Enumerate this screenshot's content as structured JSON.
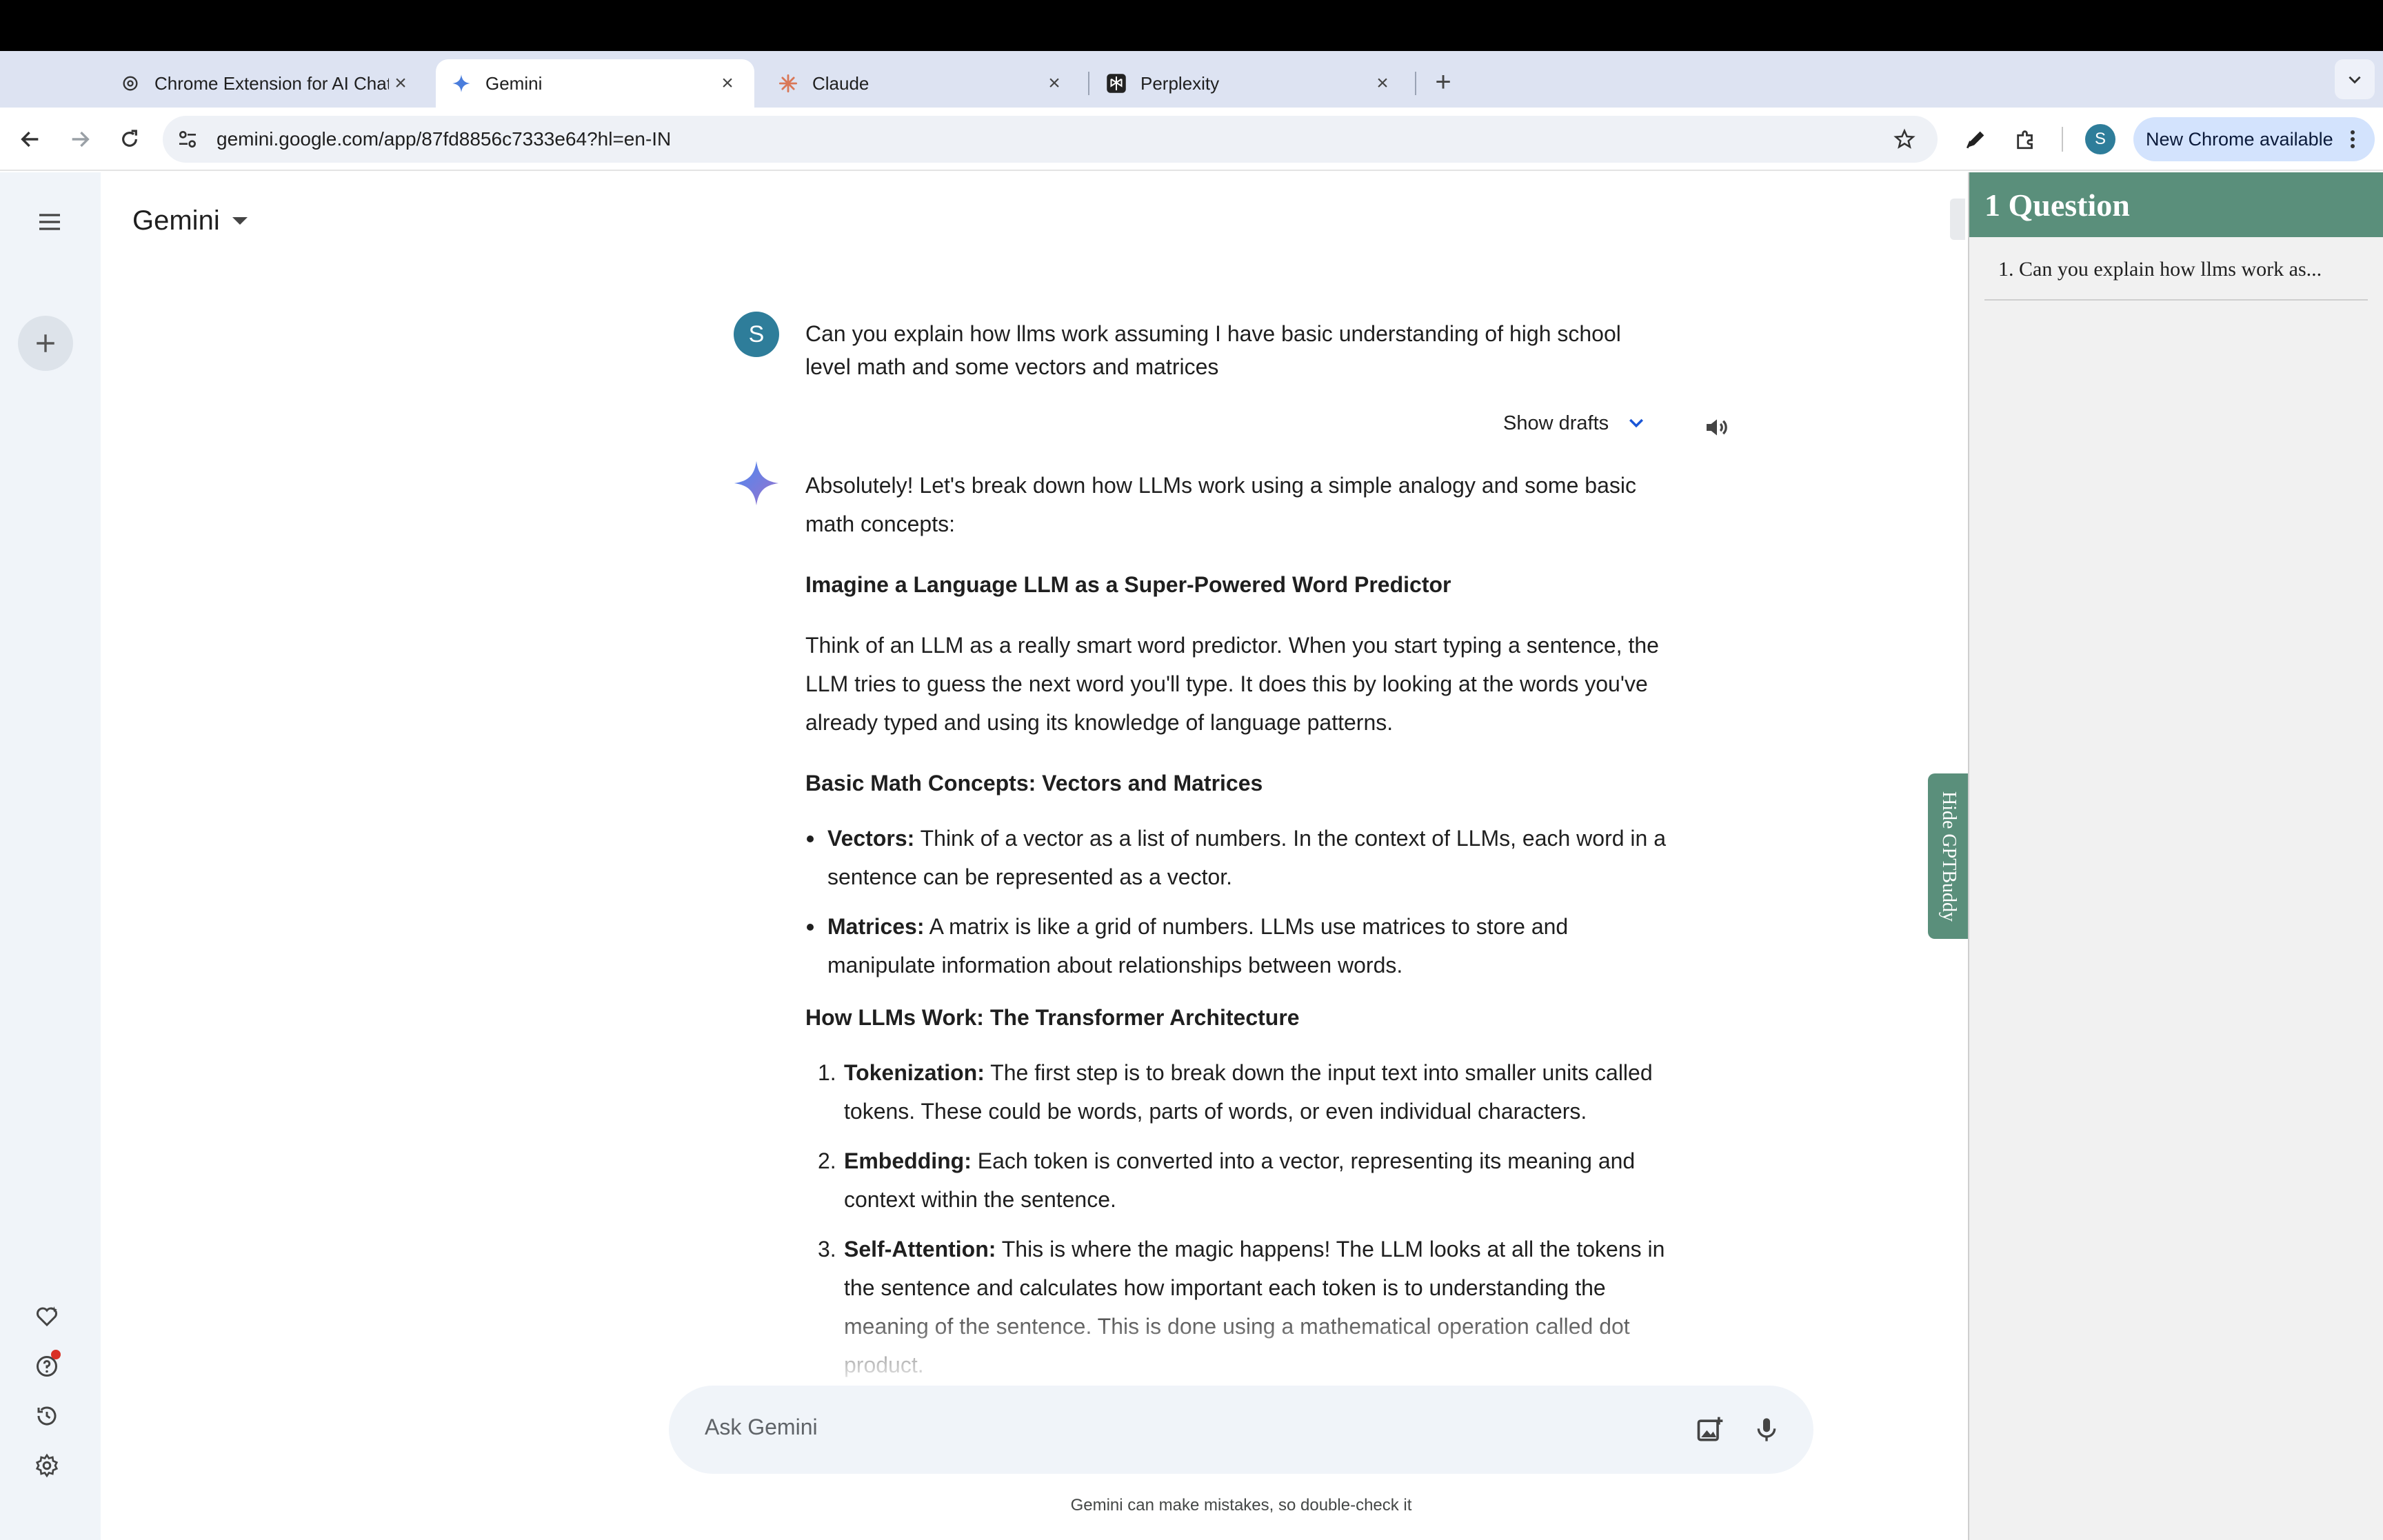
{
  "browser": {
    "tabs": [
      {
        "title": "Chrome Extension for AI Chat",
        "active": false
      },
      {
        "title": "Gemini",
        "active": true
      },
      {
        "title": "Claude",
        "active": false
      },
      {
        "title": "Perplexity",
        "active": false
      }
    ],
    "url": "gemini.google.com/app/87fd8856c7333e64?hl=en-IN",
    "profile_initial": "S",
    "update_label": "New Chrome available"
  },
  "app": {
    "brand": "Gemini"
  },
  "conversation": {
    "user_initial": "S",
    "user_question": "Can you explain how llms work assuming I have basic understanding of high school level math and some vectors and matrices",
    "show_drafts_label": "Show drafts",
    "answer": {
      "intro": "Absolutely! Let's break down how LLMs work using a simple analogy and some basic math concepts:",
      "heading1": "Imagine a Language LLM as a Super-Powered Word Predictor",
      "para1": "Think of an LLM as a really smart word predictor. When you start typing a sentence, the LLM tries to guess the next word you'll type. It does this by looking at the words you've already typed and using its knowledge of language patterns.",
      "heading2": "Basic Math Concepts: Vectors and Matrices",
      "bullets": [
        {
          "term": "Vectors:",
          "text": " Think of a vector as a list of numbers. In the context of LLMs, each word in a sentence can be represented as a vector."
        },
        {
          "term": "Matrices:",
          "text": " A matrix is like a grid of numbers. LLMs use matrices to store and manipulate information about relationships between words."
        }
      ],
      "heading3": "How LLMs Work: The Transformer Architecture",
      "steps": [
        {
          "num": "1.",
          "term": "Tokenization:",
          "text": " The first step is to break down the input text into smaller units called tokens. These could be words, parts of words, or even individual characters."
        },
        {
          "num": "2.",
          "term": "Embedding:",
          "text": " Each token is converted into a vector, representing its meaning and context within the sentence."
        },
        {
          "num": "3.",
          "term": "Self-Attention:",
          "text": " This is where the magic happens! The LLM looks at all the tokens in the sentence and calculates how important each token is to understanding the meaning of the sentence. This is done using a mathematical operation called dot product."
        }
      ]
    }
  },
  "composer": {
    "placeholder": "Ask Gemini",
    "disclaimer": "Gemini can make mistakes, so double-check it"
  },
  "side_panel": {
    "title": "1 Question",
    "items": [
      "1. Can you explain how llms work as..."
    ],
    "toggle_label": "Hide GPTBuddy"
  },
  "colors": {
    "tabstrip": "#dde3f2",
    "rail": "#f0f4f9",
    "panel_accent": "#5a8f7b",
    "avatar": "#2e7d9a",
    "update_chip": "#d3e3fd"
  }
}
